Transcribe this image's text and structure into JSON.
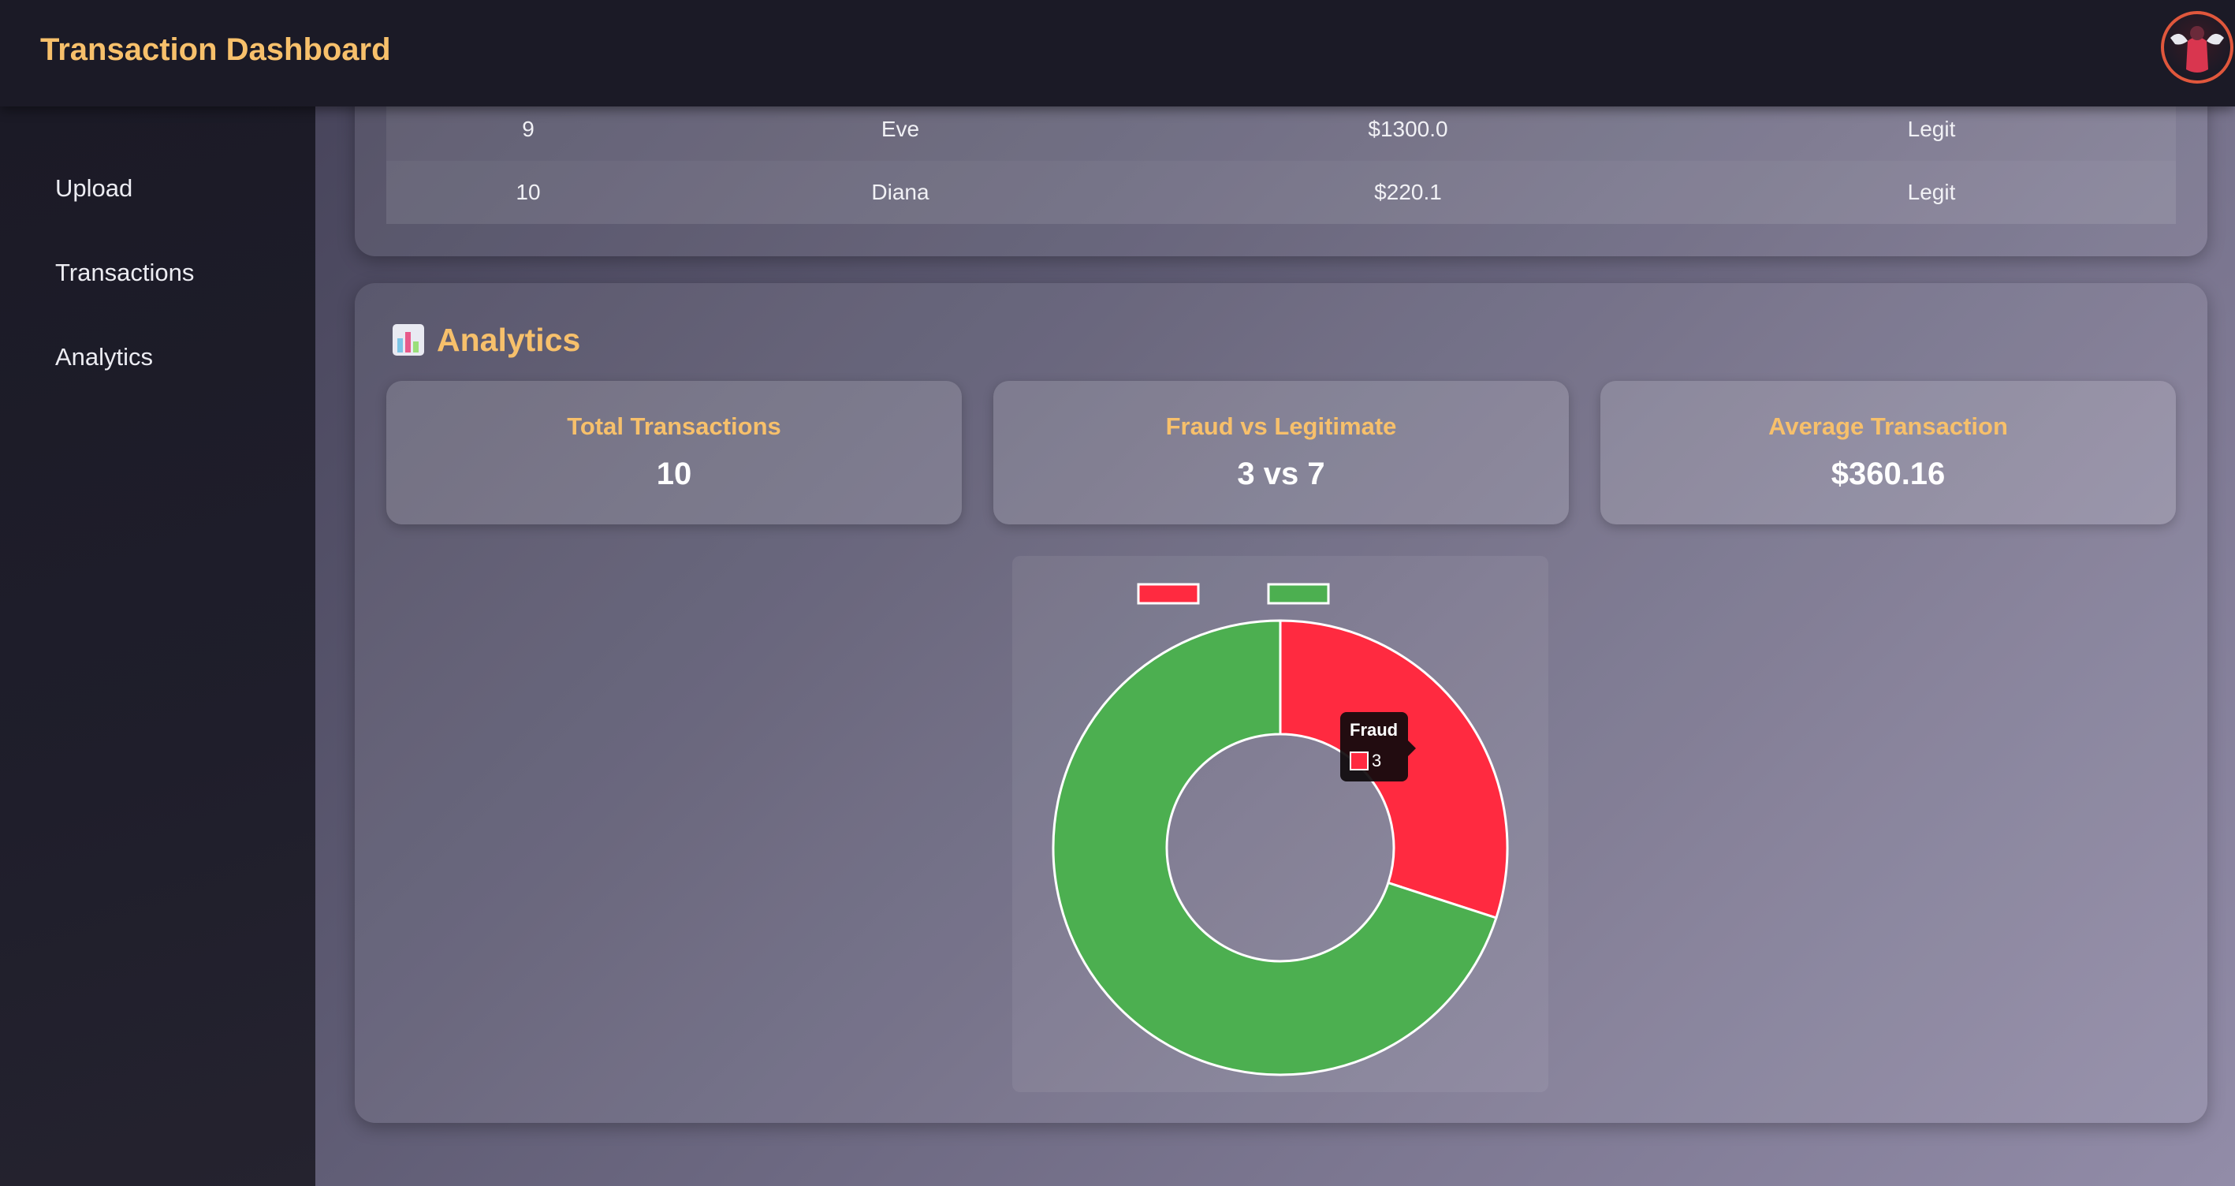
{
  "app": {
    "title": "Transaction Dashboard"
  },
  "sidebar": {
    "items": [
      {
        "label": "Upload"
      },
      {
        "label": "Transactions"
      },
      {
        "label": "Analytics"
      }
    ]
  },
  "transactions_table": {
    "rows": [
      {
        "id": "9",
        "name": "Eve",
        "amount": "$1300.0",
        "status": "Legit"
      },
      {
        "id": "10",
        "name": "Diana",
        "amount": "$220.1",
        "status": "Legit"
      }
    ]
  },
  "analytics": {
    "title": "Analytics",
    "title_icon": "bar-chart-icon",
    "stats": [
      {
        "label": "Total Transactions",
        "value": "10"
      },
      {
        "label": "Fraud vs Legitimate",
        "value": "3 vs 7"
      },
      {
        "label": "Average Transaction",
        "value": "$360.16"
      }
    ]
  },
  "chart_data": {
    "type": "pie",
    "variant": "doughnut",
    "categories": [
      "Fraud",
      ""
    ],
    "values": [
      3,
      7
    ],
    "colors": [
      "#ff2a40",
      "#4caf50"
    ],
    "legend": "top",
    "tooltip": {
      "label": "Fraud",
      "value": "3"
    }
  },
  "theme": {
    "accent": "#f7c06b",
    "topbar_bg": "#1b1a26",
    "fraud_color": "#ff2a40",
    "legit_color": "#4caf50"
  }
}
